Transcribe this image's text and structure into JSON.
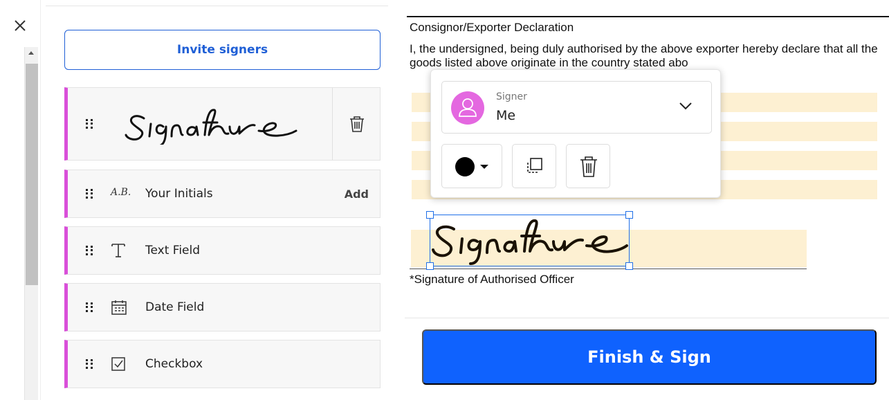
{
  "sidebar": {
    "close_icon": "close-icon",
    "invite_label": "Invite signers",
    "fields": [
      {
        "label": "Your Initials",
        "icon_text": "A.B.",
        "action": "Add"
      },
      {
        "label": "Text Field",
        "icon": "text-icon"
      },
      {
        "label": "Date Field",
        "icon": "calendar-icon"
      },
      {
        "label": "Checkbox",
        "icon": "checkbox-icon"
      }
    ],
    "signature_preview": "signature-image",
    "field_accent": "#d94fd9"
  },
  "document": {
    "heading": "Consignor/Exporter Declaration",
    "paragraph": "I, the undersigned, being duly authorised by the above exporter hereby declare that all the goods listed above originate in the country stated abo",
    "signature_caption": "*Signature of Authorised Officer",
    "highlight_color": "#fdf0d2"
  },
  "popover": {
    "signer_caption": "Signer",
    "signer_value": "Me",
    "avatar_color": "#e468e0",
    "ink_color": "#000000"
  },
  "footer": {
    "finish_label": "Finish & Sign",
    "accent": "#0f62fe"
  }
}
